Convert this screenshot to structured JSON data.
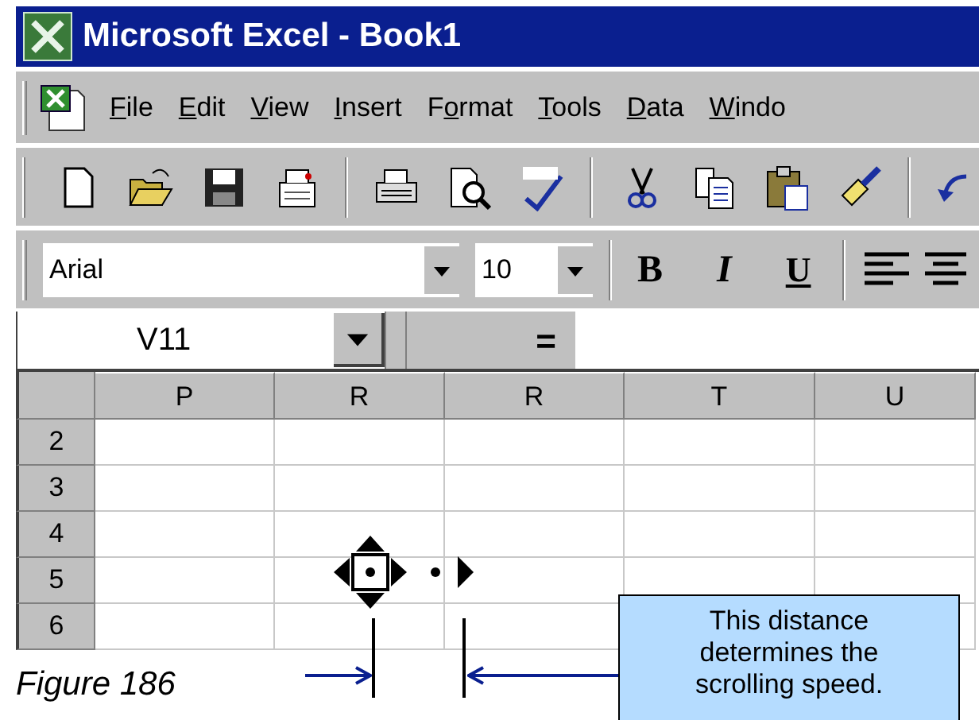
{
  "window": {
    "title": "Microsoft Excel - Book1"
  },
  "menu": [
    {
      "key": "F",
      "rest": "ile"
    },
    {
      "key": "E",
      "rest": "dit"
    },
    {
      "key": "V",
      "rest": "iew"
    },
    {
      "key": "I",
      "rest": "nsert"
    },
    {
      "lead": "F",
      "key": "o",
      "rest": "rmat"
    },
    {
      "key": "T",
      "rest": "ools"
    },
    {
      "key": "D",
      "rest": "ata"
    },
    {
      "key": "W",
      "rest": "indo"
    }
  ],
  "formatting": {
    "font": "Arial",
    "size": "10",
    "bold": "B",
    "italic": "I",
    "underline": "U"
  },
  "name_box": "V11",
  "formula_button": "=",
  "columns": [
    "P",
    "R",
    "R",
    "T",
    "U"
  ],
  "rows": [
    "2",
    "3",
    "4",
    "5",
    "6"
  ],
  "caption": "Figure 186",
  "callout": "This distance\ndetermines the\nscrolling speed."
}
